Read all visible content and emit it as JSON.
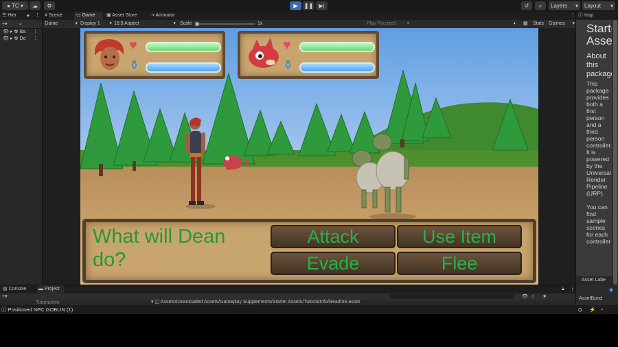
{
  "toolbar": {
    "account_label": "TC",
    "play_icon": "play-icon",
    "pause_icon": "pause-icon",
    "step_icon": "step-icon",
    "layers_label": "Layers",
    "layout_label": "Layout"
  },
  "hierarchy": {
    "tab_label": "Hier",
    "items": [
      "Ba",
      "Do"
    ]
  },
  "view_tabs": [
    "Scene",
    "Game",
    "Asset Store",
    "Animator"
  ],
  "game_toolbar": {
    "view_label": "Game",
    "display_label": "Display 1",
    "aspect_label": "16:9 Aspect",
    "scale_label": "Scale",
    "scale_value": "1x",
    "play_focused_label": "Play Focused",
    "stats_label": "Stats",
    "gizmos_label": "Gizmos"
  },
  "game": {
    "prompt_line1": "What will Dean",
    "prompt_line2": "do?",
    "actions": [
      "Attack",
      "Use Item",
      "Evade",
      "Flee"
    ],
    "player_hp_fill": 1.0,
    "player_mp_fill": 1.0,
    "enemy_hp_fill": 1.0,
    "enemy_mp_fill": 1.0
  },
  "inspector": {
    "tab_label": "Insp",
    "title": "Starter Assets",
    "about_heading": "About this package",
    "body": "This package provides both a first person and a third person controller. It is powered by the Universal Render Pipeline (URP).",
    "body2": "You can find sample scenes for each controller",
    "label_footer": "Asset Labe",
    "bundle_footer": "AssetBund"
  },
  "bottom": {
    "tabs": [
      "Console",
      "Project"
    ],
    "tree_item": "TutorialInfo",
    "path": "Assets/Downloaded Assets/Gameplay Supplements/Starter Assets/TutorialInfo/Readme.asset"
  },
  "status": {
    "message": "Positioned NPC GOBLIN (1)"
  },
  "colors": {
    "accent": "#3a6ab0",
    "prompt_text": "#1f9a39",
    "action_text": "#29b048"
  }
}
